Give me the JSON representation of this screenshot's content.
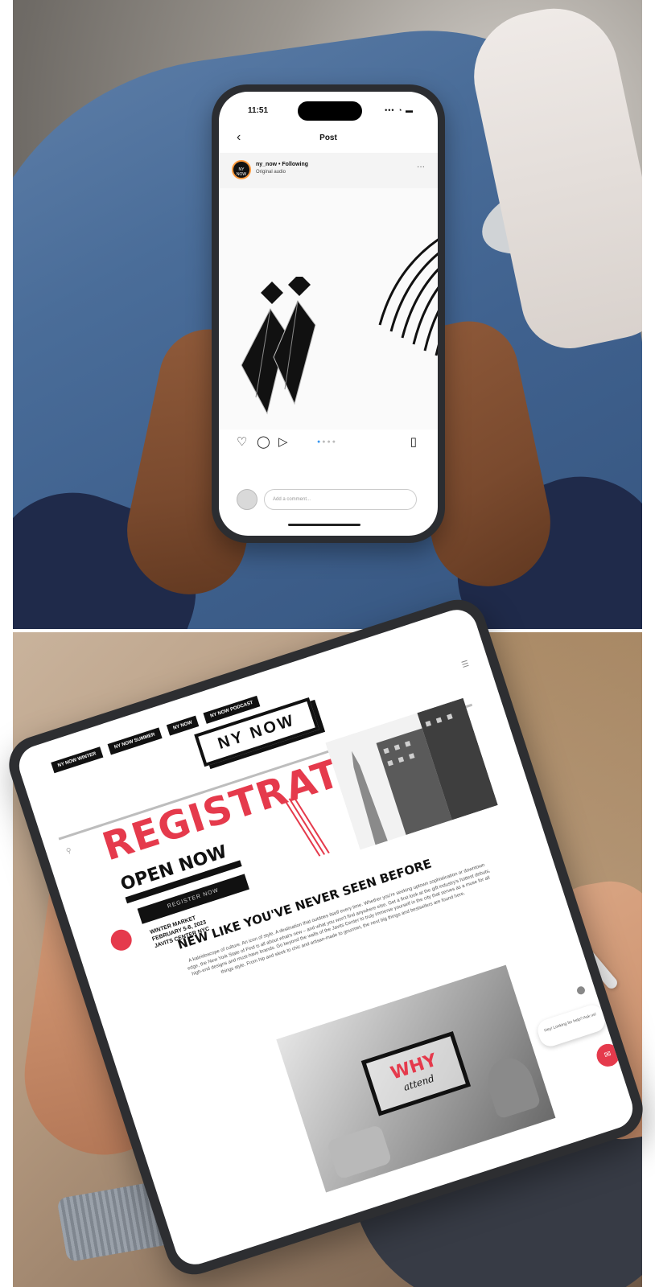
{
  "phone": {
    "status_time": "11:51",
    "status_icons": "••• ◔ ▬",
    "nav_title": "Post",
    "back_icon": "chevron-left-icon",
    "post": {
      "username_line": "ny_now • Following",
      "audio_line": "Original audio",
      "avatar_label": "NY NOW",
      "carousel_index": 1,
      "carousel_total": 4
    },
    "comment_placeholder": "Add a comment..."
  },
  "tablet": {
    "top_nav": [
      "NY NOW WINTER",
      "NY NOW SUMMER",
      "NY NOW",
      "NY NOW PODCAST"
    ],
    "logo": "NY NOW",
    "hero": {
      "title": "REGISTRATION",
      "subtitle": "OPEN NOW",
      "button": "REGISTER NOW",
      "event_info": "WINTER MARKET\nFEBRUARY 5-8, 2023\nJAVITS CENTER NYC"
    },
    "headline": "NEW LIKE YOU'VE NEVER SEEN BEFORE",
    "body": "A kaleidoscope of culture. An icon of style. A destination that outdoes itself every time. Whether you're seeking uptown sophistication or downtown edge, the New York State of Find is all about what's new – and what you won't find anywhere else. Get a first look at the gift industry's hottest debuts, high-end designs and must-have brands. Go beyond the walls of the Javits Center to truly immerse yourself in the city that serves as a muse for all things style. From hip and sleek to chic and artisan-made to gourmet, the next big things and bestsellers are found here.",
    "feature": {
      "word": "WHY",
      "sub": "attend"
    },
    "chat_bubble": "Hey! Looking for help? Ask us!",
    "chat_icon": "chat-icon"
  },
  "colors": {
    "accent": "#e53a4c",
    "instagram_blue": "#3897f0"
  }
}
